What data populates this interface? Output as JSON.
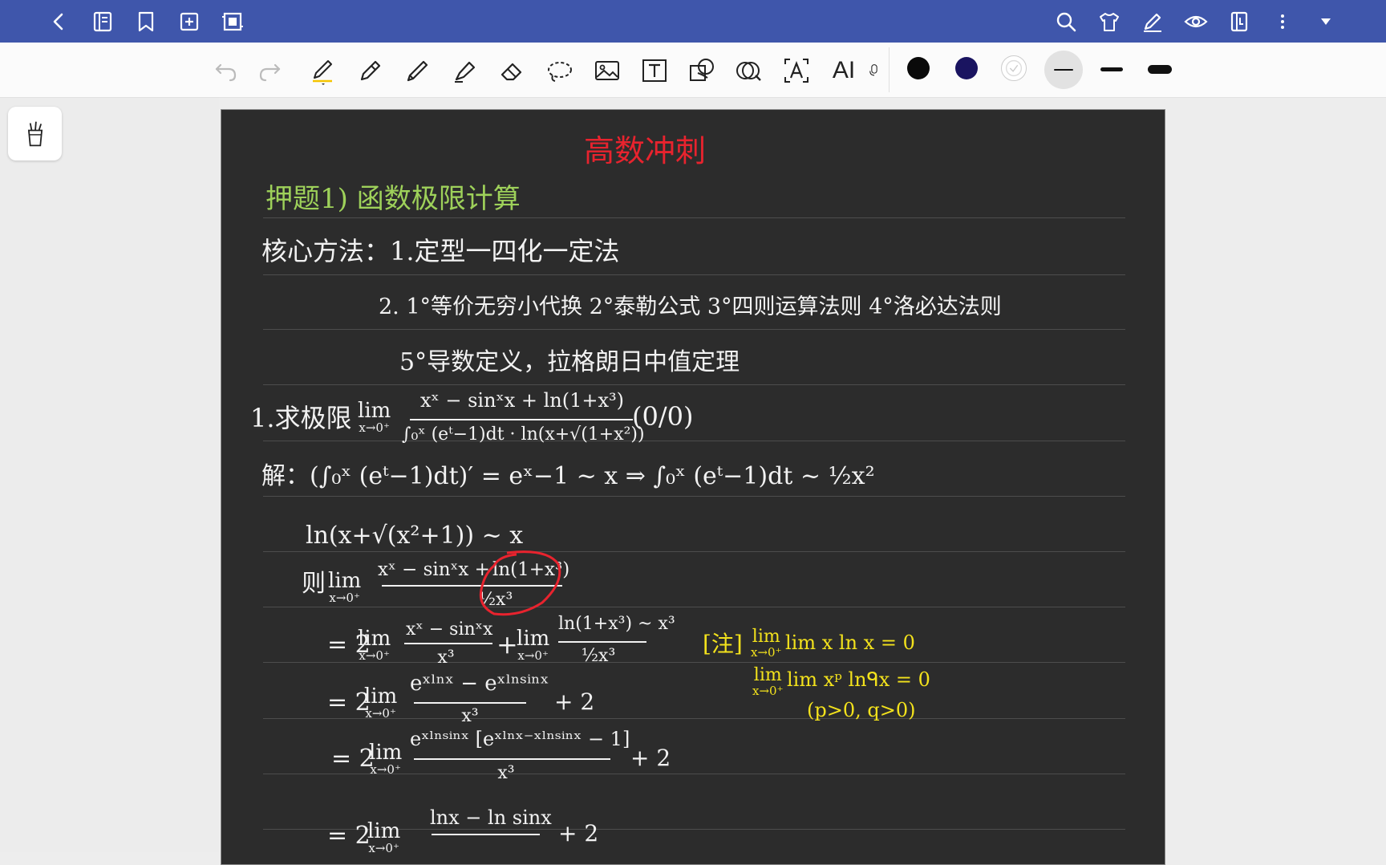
{
  "toolbar": {
    "ai_label": "AI",
    "colors": {
      "black": "#0a0a0a",
      "navy": "#1a1460",
      "white": "#ffffff"
    },
    "pen_highlight_color": "#f5c400"
  },
  "note": {
    "title": "高数冲刺",
    "section": "押题1) 函数极限计算",
    "core_method": "核心方法：1.定型一四化一定法",
    "methods_line": "2. 1°等价无穷小代换   2°泰勒公式   3°四则运算法则   4°洛必达法则",
    "methods_line2": "5°导数定义，拉格朗日中值定理",
    "problem": {
      "prefix": "1.求极限",
      "lim": "lim",
      "lim_sub": "x→0⁺",
      "numerator": "xˣ − sinˣx + ln(1+x³)",
      "denominator": "∫₀ˣ (eᵗ−1)dt · ln(x+√(1+x²))",
      "form": "(0/0)"
    },
    "solution": {
      "line1": "解：(∫₀ˣ (eᵗ−1)dt)′ = eˣ−1 ~ x ⇒ ∫₀ˣ (eᵗ−1)dt ~ ½x²",
      "line2": "ln(x+√(x²+1)) ~ x",
      "then_prefix": "则",
      "then_numerator_left": "xˣ − sinˣx +",
      "then_numerator_circled": "ln(1+x³)",
      "then_denominator": "½x³",
      "step1_prefix": "= 2",
      "step1_num1": "xˣ − sinˣx",
      "step1_den1": "x³",
      "step1_plus": "+",
      "step1_num2": "ln(1+x³) ~ x³",
      "step1_den2": "½x³",
      "step2_prefix": "= 2",
      "step2_num": "eˣˡⁿˣ − eˣˡⁿˢⁱⁿˣ",
      "step2_den": "x³",
      "step2_suffix": "+ 2",
      "step3_prefix": "= 2",
      "step3_num": "eˣˡⁿˢⁱⁿˣ [eˣˡⁿˣ⁻ˣˡⁿˢⁱⁿˣ − 1]",
      "step3_den": "x³",
      "step3_suffix": "+ 2",
      "step4_prefix": "= 2",
      "step4_num": "lnx − ln sinx",
      "step4_suffix": "+ 2"
    },
    "remark": {
      "label": "[注]",
      "line1": "lim x ln x = 0",
      "line1_sub": "x→0⁺",
      "line2": "lim xᵖ lnᑫx = 0",
      "line2_sub": "x→0⁺",
      "line3": "(p>0, q>0)"
    }
  }
}
